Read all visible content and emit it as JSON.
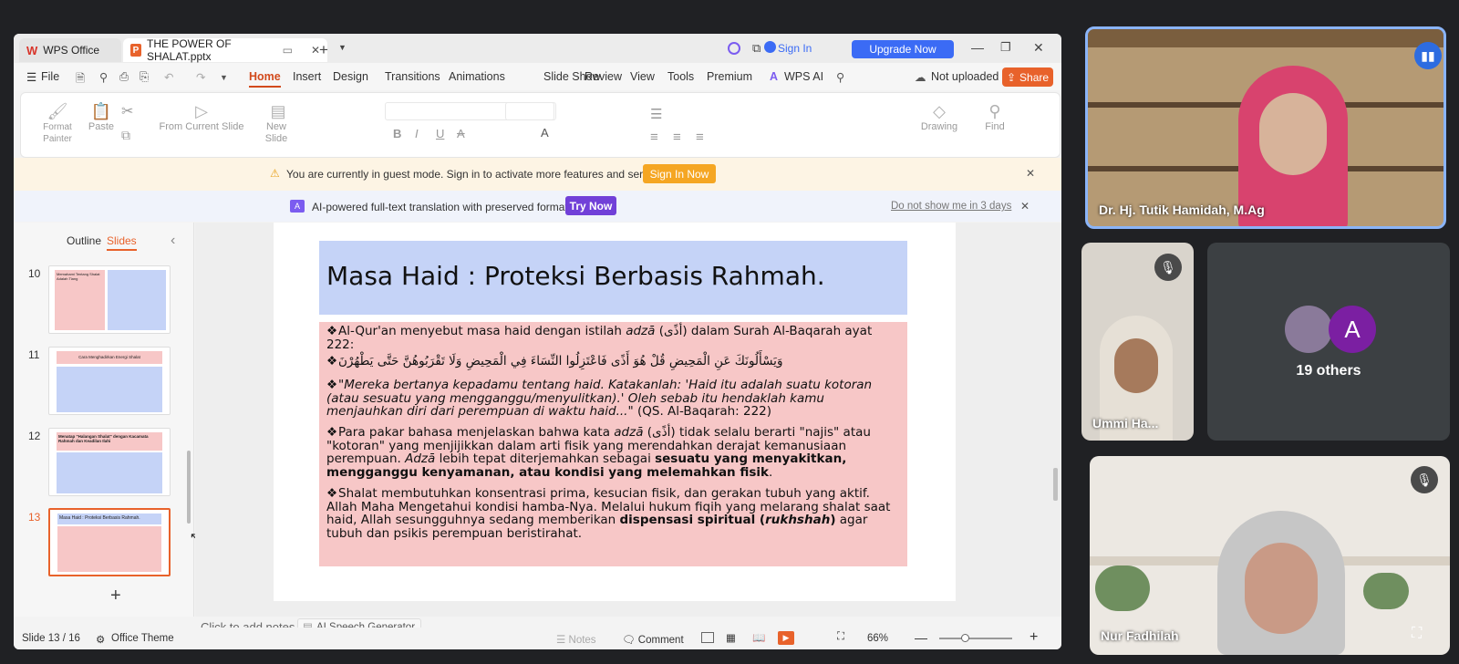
{
  "app": {
    "tabs": [
      {
        "label": "WPS Office"
      },
      {
        "label": "THE POWER OF SHALAT.pptx"
      }
    ],
    "sign_in": "Sign In",
    "upgrade": "Upgrade Now",
    "menu": [
      "File",
      "Home",
      "Insert",
      "Design",
      "Transitions",
      "Animations",
      "Slide Show",
      "Review",
      "View",
      "Tools",
      "Premium",
      "WPS AI"
    ],
    "not_uploaded": "Not uploaded",
    "share": "Share"
  },
  "ribbon": {
    "format_painter": "Format Painter",
    "paste": "Paste",
    "from_current_slide": "From Current Slide",
    "new_slide": "New Slide",
    "drawing": "Drawing",
    "find": "Find"
  },
  "guest_banner": {
    "text": "You are currently in guest mode. Sign in to activate more features and services.",
    "button": "Sign In Now"
  },
  "ai_banner": {
    "text": "AI-powered full-text translation with preserved formatting.",
    "button": "Try Now",
    "dismiss": "Do not show me in 3 days"
  },
  "panel": {
    "outline_tab": "Outline",
    "slides_tab": "Slides",
    "numbers": [
      "10",
      "11",
      "12",
      "13"
    ],
    "thumb_titles": [
      "Memahami Tentang Shalat Adalah Tiang",
      "Cara Menghadirkan Energi Shalat",
      "Menatap \"Halangan Shalat\" dengan Kacamata Rahmah dan Keadilan Ilahi",
      "Masa Haid : Proteksi Berbasis Rahmah."
    ]
  },
  "slide": {
    "title": "Masa Haid : Proteksi Berbasis Rahmah.",
    "b1a": "Al-Qur'an menyebut masa haid dengan istilah ",
    "b1b": "adzā",
    "b1c": " (أذًى) dalam Surah Al-Baqarah ayat 222:",
    "b2": "وَيَسْأَلُونَكَ عَنِ الْمَحِيضِ قُلْ هُوَ أَذًى فَاعْتَزِلُوا النِّسَاءَ فِي الْمَحِيضِ وَلَا تَقْرَبُوهُنَّ حَتَّى يَطْهُرْنَ",
    "b3a": "\"Mereka bertanya kepadamu tentang haid. Katakanlah: 'Haid itu adalah suatu kotoran (atau sesuatu yang mengganggu/menyulitkan).' Oleh sebab itu hendaklah kamu menjauhkan diri dari perempuan di waktu haid...\"",
    "b3b": " (QS. Al-Baqarah: 222)",
    "b4a": "Para pakar bahasa menjelaskan bahwa kata ",
    "b4b": "adzā",
    "b4c": " (أذًى) tidak selalu berarti \"najis\" atau \"kotoran\" yang menjijikkan dalam arti fisik yang merendahkan derajat kemanusiaan perempuan. ",
    "b4d": "Adzā",
    "b4e": " lebih tepat diterjemahkan sebagai ",
    "b4f": "sesuatu yang menyakitkan, mengganggu kenyamanan, atau kondisi yang melemahkan fisik",
    "b4g": ".",
    "b5a": "Shalat membutuhkan konsentrasi prima, kesucian fisik, dan gerakan tubuh yang aktif. Allah Maha Mengetahui kondisi hamba-Nya. Melalui hukum fiqih yang melarang shalat saat haid, Allah sesungguhnya sedang memberikan ",
    "b5b": "dispensasi spiritual (",
    "b5c": "rukhshah",
    "b5d": ")",
    "b5e": " agar tubuh dan psikis perempuan beristirahat."
  },
  "notes": {
    "placeholder": "Click to add notes",
    "speech": "AI Speech Generator"
  },
  "status": {
    "slide": "Slide 13 / 16",
    "theme": "Office Theme",
    "notes": "Notes",
    "comment": "Comment",
    "zoom": "66%"
  },
  "meeting": {
    "p1": "Dr. Hj. Tutik Hamidah, M.Ag",
    "p2": "Ummi Ha...",
    "others": "19 others",
    "others_initial": "A",
    "p3": "Nur Fadhilah"
  },
  "colors": {
    "accent": "#e8622b",
    "upgrade": "#3b6bf5",
    "title_bg": "#c5d3f7",
    "body_bg": "#f7c7c7",
    "ai": "#7140d8"
  }
}
